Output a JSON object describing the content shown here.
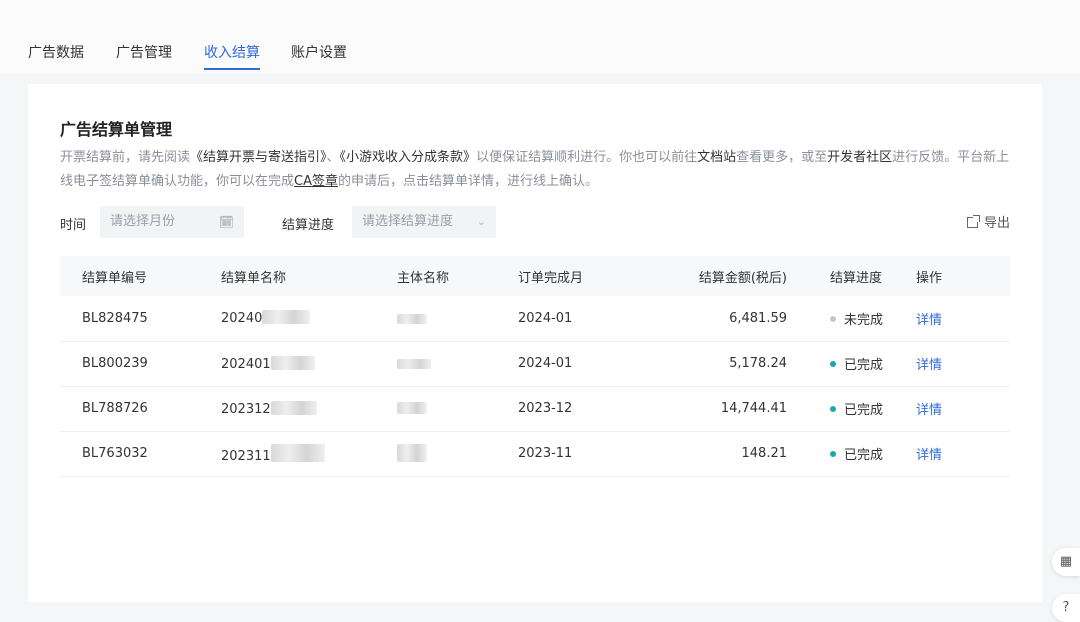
{
  "tabs": [
    {
      "label": "广告数据",
      "active": false
    },
    {
      "label": "广告管理",
      "active": false
    },
    {
      "label": "收入结算",
      "active": true
    },
    {
      "label": "账户设置",
      "active": false
    }
  ],
  "card": {
    "title": "广告结算单管理",
    "desc": {
      "p1": "开票结算前，请先阅读",
      "link1": "《结算开票与寄送指引》",
      "p2": "、",
      "link2": "《小游戏收入分成条款》",
      "p3": "以便保证结算顺利进行。你也可以前往",
      "link3": "文档站",
      "p4": "查看更多，或至",
      "link4": "开发者社区",
      "p5": "进行反馈。平台新上线电子签结算单确认功能，你可以在完成",
      "link5": "CA签章",
      "p6": "的申请后，点击结算单详情，进行线上确认。"
    }
  },
  "filters": {
    "time_label": "时间",
    "time_placeholder": "请选择月份",
    "progress_label": "结算进度",
    "progress_placeholder": "请选择结算进度",
    "export_label": "导出"
  },
  "table": {
    "headers": [
      "结算单编号",
      "结算单名称",
      "主体名称",
      "订单完成月",
      "结算金额(税后)",
      "结算进度",
      "操作"
    ],
    "rows": [
      {
        "no": "BL828475",
        "name_prefix": "20240",
        "month": "2024-01",
        "amount": "6,481.59",
        "status": "未完成",
        "action": "详情"
      },
      {
        "no": "BL800239",
        "name_prefix": "202401",
        "month": "2024-01",
        "amount": "5,178.24",
        "status": "已完成",
        "action": "详情"
      },
      {
        "no": "BL788726",
        "name_prefix": "202312",
        "month": "2023-12",
        "amount": "14,744.41",
        "status": "已完成",
        "action": "详情"
      },
      {
        "no": "BL763032",
        "name_prefix": "202311",
        "month": "2023-11",
        "amount": "148.21",
        "status": "已完成",
        "action": "详情"
      }
    ]
  },
  "colors": {
    "accent": "#2f6bd9",
    "status_done": "#1aa7b0",
    "status_pending": "#c4c8ce"
  },
  "float_buttons": {
    "qr_icon": "qr-code-icon",
    "help_icon": "help-circle-icon"
  }
}
